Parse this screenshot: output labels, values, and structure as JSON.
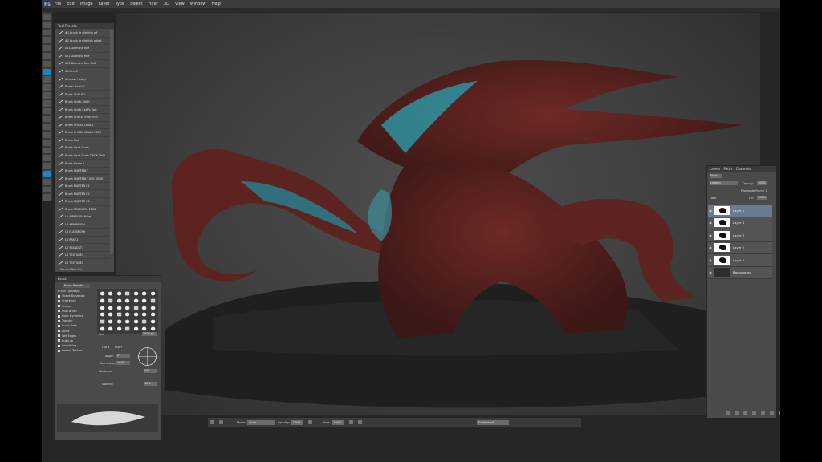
{
  "app": {
    "logo": "Ps"
  },
  "menu": [
    "File",
    "Edit",
    "Image",
    "Layer",
    "Type",
    "Select",
    "Filter",
    "3D",
    "View",
    "Window",
    "Help"
  ],
  "tool_presets": {
    "title": "Tool Presets",
    "items": [
      "#1 Brush fe cile thin off",
      "#1 Brush fe cile thin offset",
      "001 Diamond fine",
      "002 Diamond fine",
      "003 Diamond fine Soft",
      "3B Pencil",
      "Airbrush Heavy",
      "Brushi Brush 2",
      "Brush CHALK 2",
      "Brush Chalk EXCH",
      "Brush Chalk Ext Pz Soft",
      "Brush CHALK Thick Thin",
      "Brush CHISEL CHALK",
      "Brush CHISEL CHALK HEMI",
      "Brush Flat",
      "Brush Hard Circle",
      "Brush Hard Circle THICK THIN",
      "Brush Hexes 1",
      "Brush PAINTERLY",
      "Brush PAINTERLY SOS GRUE",
      "Brush PAINTER 01",
      "Brush PAINTER 02",
      "Brush PAINTER 03",
      "Brush TEXTURE2 2E38",
      "LB AIRBRUSH Bake",
      "LB ARMBRUSH",
      "LB FLATBRUSH",
      "LB RAKE1",
      "LB STANDST1",
      "LB TEXTURE1",
      "LB TEXTURE2",
      "Color Brush",
      "Embers 1",
      "Embers 2"
    ],
    "footer": "Current Tool Only"
  },
  "brush": {
    "title": "Brush",
    "presets_button": "Brush Presets",
    "options": [
      "Brush Tip Shape",
      "Shape Dynamics",
      "Scattering",
      "Texture",
      "Dual Brush",
      "Color Dynamics",
      "Transfer",
      "Brush Pose",
      "Noise",
      "Wet Edges",
      "Build-up",
      "Smoothing",
      "Protect Texture"
    ],
    "size_label": "Size",
    "size_value": "2000 px",
    "flip_x": "Flip X",
    "flip_y": "Flip Y",
    "angle_label": "Angle:",
    "angle_value": "0°",
    "roundness_label": "Roundness:",
    "roundness_value": "100%",
    "hardness_label": "Hardness",
    "hardness_value": "0%",
    "spacing_label": "Spacing",
    "spacing_value": "10%"
  },
  "layers_panel": {
    "tabs": [
      "Layers",
      "Paths",
      "Channels"
    ],
    "kind_label": "Kind",
    "blend_mode": "Lighten",
    "opacity_label": "Opacity:",
    "opacity_value": "100%",
    "lock_label": "Lock:",
    "fill_label": "Fill:",
    "fill_value": "100%",
    "propagate_label": "Propagate Frame 1",
    "layers": [
      {
        "name": "Layer 1",
        "selected": true
      },
      {
        "name": "Layer 4",
        "selected": false
      },
      {
        "name": "Layer 3",
        "selected": false
      },
      {
        "name": "Layer 2",
        "selected": false
      },
      {
        "name": "Layer 5",
        "selected": false
      },
      {
        "name": "Background",
        "selected": false
      }
    ]
  },
  "options_bar": {
    "mode_label": "Mode:",
    "mode_value": "Color",
    "opacity_label": "Opacity:",
    "opacity_value": "100%",
    "flow_label": "Flow:",
    "flow_value": "100%",
    "sample_value": "Screenshot"
  }
}
